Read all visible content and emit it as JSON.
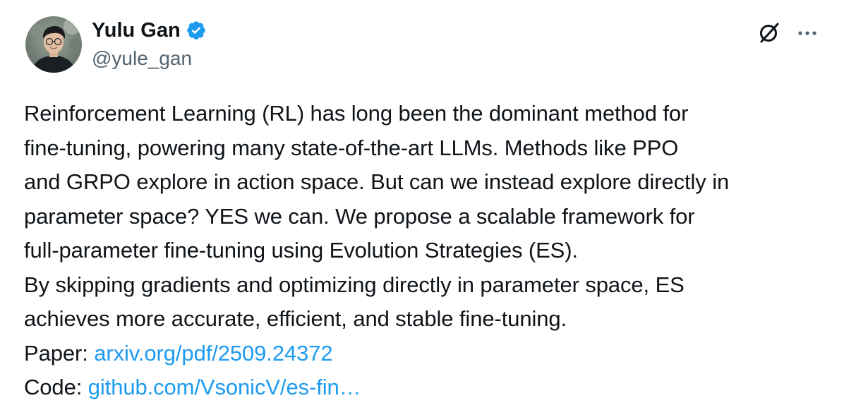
{
  "author": {
    "display_name": "Yulu Gan",
    "handle": "@yule_gan",
    "verified": true,
    "verified_color": "#1d9bf0"
  },
  "icons": {
    "avatar": "profile-photo",
    "verified": "verified-badge-icon",
    "grok": "grok-icon",
    "more": "more-options-icon"
  },
  "tweet": {
    "lines": [
      "Reinforcement Learning (RL) has long been the dominant method for",
      "fine-tuning, powering many state-of-the-art LLMs. Methods like PPO",
      "and GRPO explore in action space. But can we instead explore directly in",
      "parameter space? YES we can. We propose a scalable framework for",
      "full-parameter fine-tuning using Evolution Strategies (ES).",
      "By skipping gradients and optimizing directly in parameter space, ES",
      "achieves more accurate, efficient, and stable fine-tuning."
    ],
    "paper_label": "Paper: ",
    "paper_link": "arxiv.org/pdf/2509.24372",
    "code_label": "Code: ",
    "code_link": "github.com/VsonicV/es-fin…"
  },
  "colors": {
    "text": "#0f1419",
    "secondary": "#536471",
    "link": "#1d9bf0"
  }
}
